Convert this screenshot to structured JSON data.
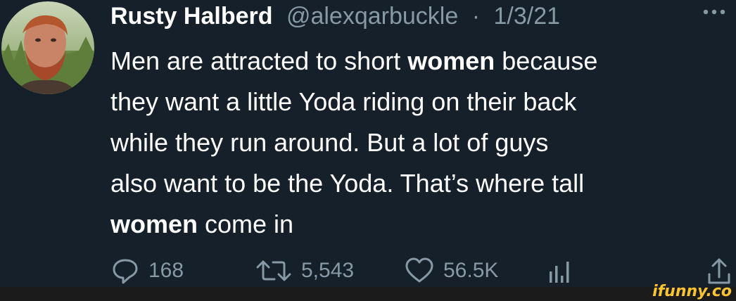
{
  "tweet": {
    "display_name": "Rusty Halberd",
    "handle": "@alexqarbuckle",
    "separator": "·",
    "date": "1/3/21",
    "more_icon": "more-horizontal-icon",
    "body": {
      "line1_a": "Men are attracted to short ",
      "line1_bold": "women",
      "line1_b": " because",
      "line2": "they want a little Yoda riding on their back",
      "line3": "while they run around. But a lot of guys",
      "line4": "also want to be the Yoda. That’s where tall",
      "line5_bold": "women",
      "line5_b": " come in"
    },
    "actions": {
      "reply": {
        "icon": "reply-icon",
        "count": "168"
      },
      "retweet": {
        "icon": "retweet-icon",
        "count": "5,543"
      },
      "like": {
        "icon": "heart-icon",
        "count": "56.5K"
      },
      "analytics": {
        "icon": "analytics-icon"
      },
      "share": {
        "icon": "share-icon"
      }
    }
  },
  "watermark": "ifunny.co",
  "colors": {
    "background": "#15202b",
    "text": "#ffffff",
    "secondary": "#8899a6",
    "watermark": "#f7c531"
  }
}
